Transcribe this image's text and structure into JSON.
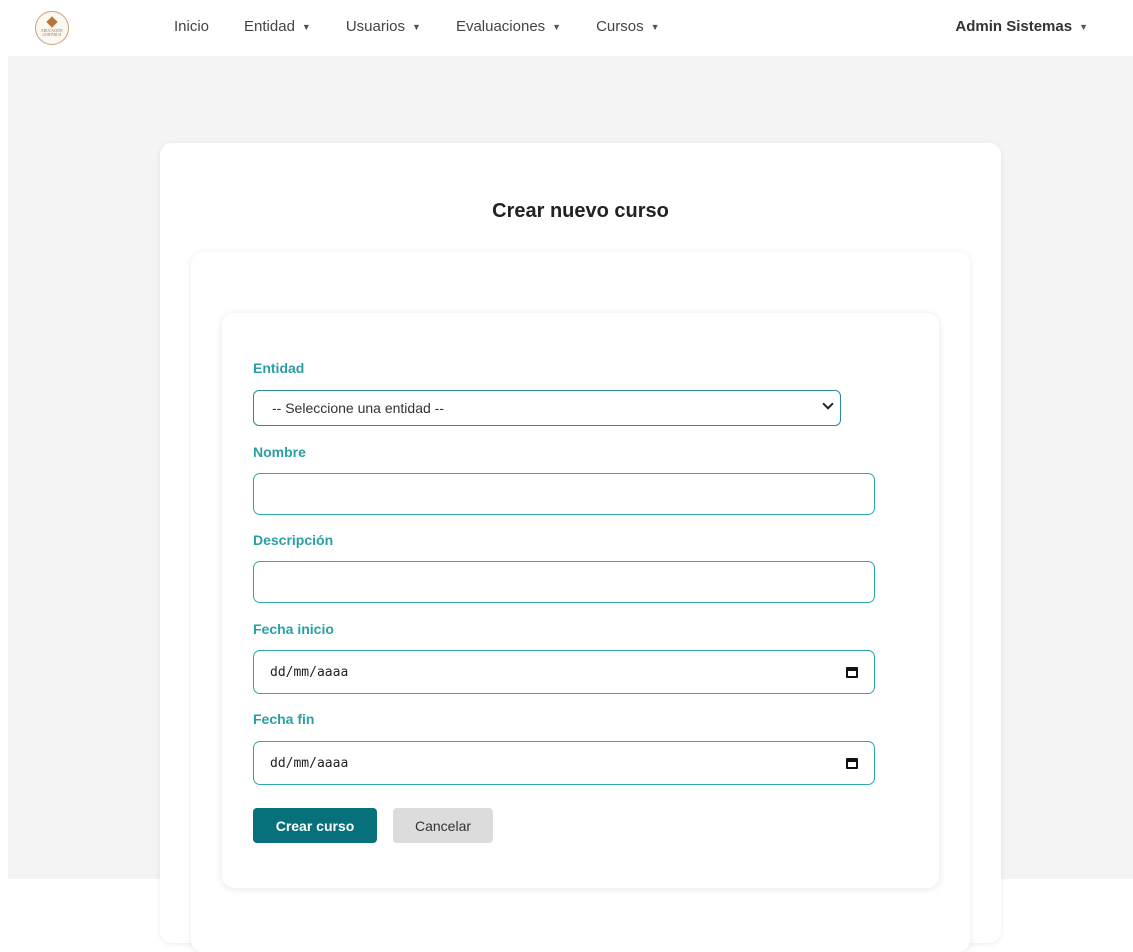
{
  "brand": {
    "logo_text": "EDUCACIÓN CONTINUA"
  },
  "nav": {
    "items": [
      {
        "label": "Inicio",
        "dropdown": false
      },
      {
        "label": "Entidad",
        "dropdown": true
      },
      {
        "label": "Usuarios",
        "dropdown": true
      },
      {
        "label": "Evaluaciones",
        "dropdown": true
      },
      {
        "label": "Cursos",
        "dropdown": true
      }
    ],
    "user": "Admin Sistemas",
    "caret": "▼"
  },
  "page": {
    "title": "Crear nuevo curso"
  },
  "form": {
    "entidad": {
      "label": "Entidad",
      "selected": "-- Seleccione una entidad --"
    },
    "nombre": {
      "label": "Nombre",
      "value": ""
    },
    "descripcion": {
      "label": "Descripción",
      "value": ""
    },
    "fecha_inicio": {
      "label": "Fecha inicio",
      "placeholder": "dd/mm/aaaa"
    },
    "fecha_fin": {
      "label": "Fecha fin",
      "placeholder": "dd/mm/aaaa"
    },
    "submit_label": "Crear curso",
    "cancel_label": "Cancelar"
  },
  "colors": {
    "accent": "#06707b",
    "label": "#2a9fa4",
    "background": "#f4f4f4"
  }
}
